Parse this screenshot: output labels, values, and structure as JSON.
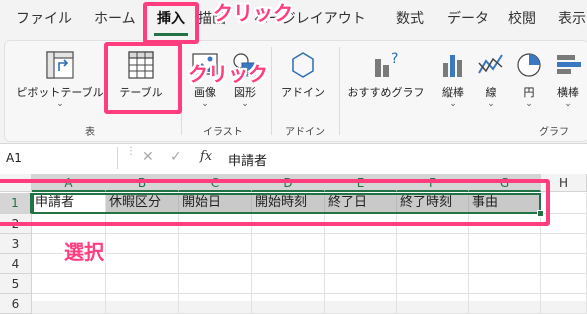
{
  "ribbon_tabs": [
    "ファイル",
    "ホーム",
    "挿入",
    "描画",
    "ページレイアウト",
    "数式",
    "データ",
    "校閲",
    "表示"
  ],
  "active_tab": "挿入",
  "ribbon": {
    "pivot_label": "ピボットテーブル",
    "table_label": "テーブル",
    "image_label": "画像",
    "shape_label": "図形",
    "addin_label": "アドイン",
    "rec_chart_label": "おすすめグラフ",
    "bar_label": "縦棒",
    "line_label": "線",
    "pie_label": "円",
    "hbar_label": "横棒",
    "chevron": "⌄",
    "groups": {
      "table": "表",
      "illust": "イラスト",
      "addin": "アドイン",
      "chart": "グラフ"
    }
  },
  "formula_bar": {
    "name_box": "A1",
    "cancel_glyph": "✕",
    "confirm_glyph": "✓",
    "fx": "fx",
    "value": "申請者"
  },
  "grid": {
    "columns": [
      "A",
      "B",
      "C",
      "D",
      "E",
      "F",
      "G",
      "H"
    ],
    "rows": [
      "1",
      "2",
      "3",
      "4",
      "5",
      "6"
    ],
    "row1": [
      "申請者",
      "休暇区分",
      "開始日",
      "開始時刻",
      "終了日",
      "終了時刻",
      "事由"
    ]
  },
  "annotations": {
    "click1": "クリック",
    "click2": "クリック",
    "select": "選択",
    "color": "#ff3d7f"
  }
}
